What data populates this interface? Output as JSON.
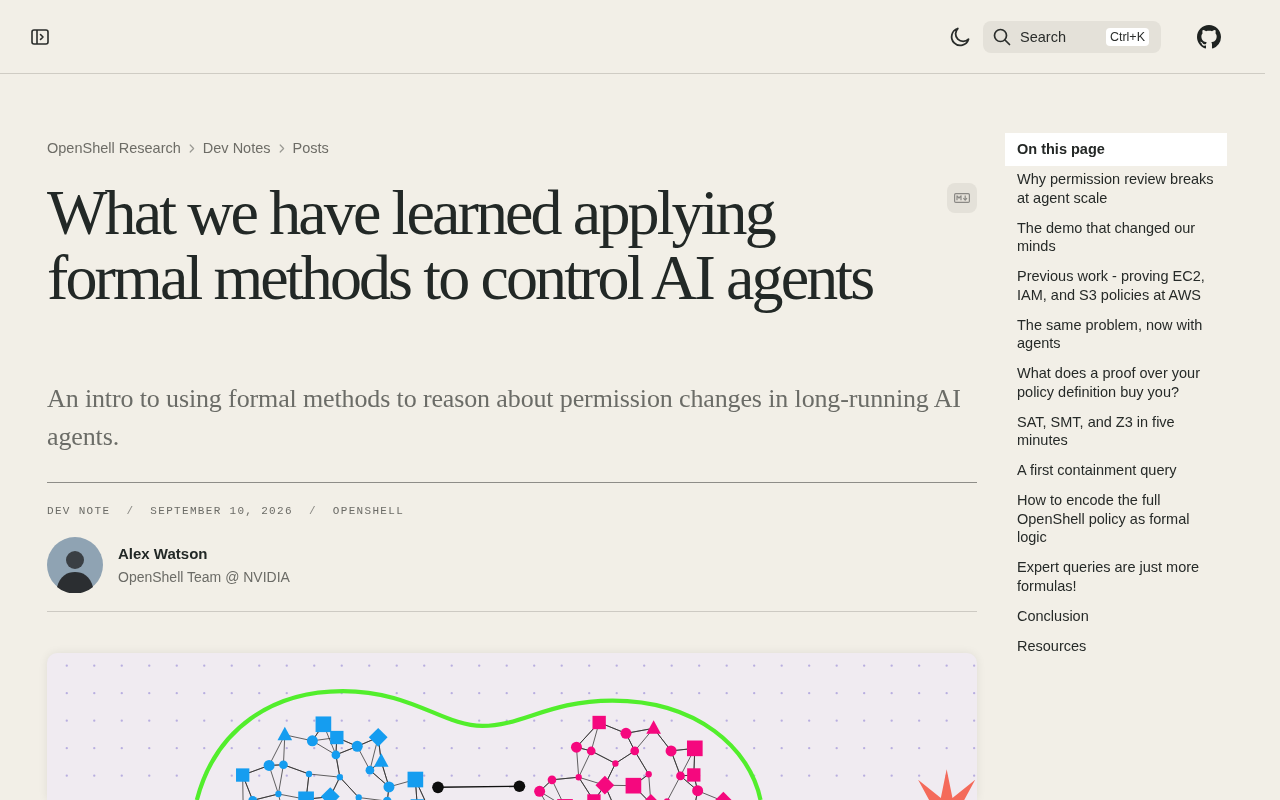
{
  "top_bar": {
    "search": {
      "label": "Search",
      "shortcut": "Ctrl+K"
    }
  },
  "breadcrumb": [
    {
      "label": "OpenShell Research"
    },
    {
      "label": "Dev Notes"
    },
    {
      "label": "Posts"
    }
  ],
  "article": {
    "title": "What we have learned applying formal methods to control AI agents",
    "subtitle": "An intro to using formal methods to reason about permission changes in long-running AI agents.",
    "meta": [
      {
        "kind": "label",
        "text": "DEV NOTE"
      },
      {
        "kind": "separator",
        "text": "/"
      },
      {
        "kind": "label",
        "text": "SEPTEMBER 10, 2026"
      },
      {
        "kind": "separator",
        "text": "/"
      },
      {
        "kind": "label",
        "text": "OPENSHELL"
      }
    ],
    "author": {
      "name": "Alex Watson",
      "role": "OpenShell Team @ NVIDIA"
    }
  },
  "toc": {
    "title": "On this page",
    "items": [
      {
        "label": "Why permission review breaks at agent scale"
      },
      {
        "label": "The demo that changed our minds"
      },
      {
        "label": "Previous work - proving EC2, IAM, and S3 policies at AWS"
      },
      {
        "label": "The same problem, now with agents"
      },
      {
        "label": "What does a proof over your policy definition buy you?"
      },
      {
        "label": "SAT, SMT, and Z3 in five minutes"
      },
      {
        "label": "A first containment query"
      },
      {
        "label": "How to encode the full OpenShell policy as formal logic"
      },
      {
        "label": "Expert queries are just more formulas!"
      },
      {
        "label": "Conclusion"
      },
      {
        "label": "Resources"
      }
    ]
  }
}
